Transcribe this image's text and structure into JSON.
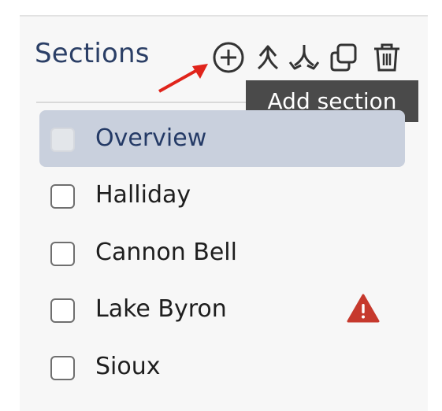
{
  "panel": {
    "title": "Sections"
  },
  "toolbar": {
    "add_icon": "plus-circle-icon",
    "move_up_icon": "move-up-icon",
    "split_icon": "split-icon",
    "duplicate_icon": "duplicate-icon",
    "delete_icon": "trash-icon",
    "tooltip": "Add section"
  },
  "annotation": {
    "arrow_color": "#e0241b"
  },
  "sections": {
    "items": [
      {
        "label": "Overview",
        "selected": true,
        "warning": false
      },
      {
        "label": "Halliday",
        "selected": false,
        "warning": false
      },
      {
        "label": "Cannon Bell",
        "selected": false,
        "warning": false
      },
      {
        "label": "Lake Byron",
        "selected": false,
        "warning": true
      },
      {
        "label": "Sioux",
        "selected": false,
        "warning": false
      }
    ]
  },
  "colors": {
    "title": "#2b3f66",
    "selected_bg": "#c9d0dd",
    "warning": "#c6392d",
    "tooltip_bg": "#4a4a4a"
  }
}
